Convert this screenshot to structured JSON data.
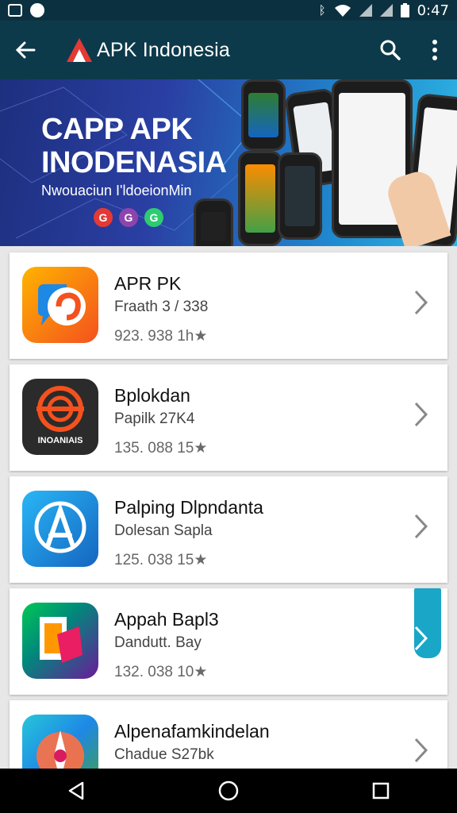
{
  "status_bar": {
    "time": "0:47",
    "icons": [
      "image-icon",
      "sync-icon",
      "bluetooth-icon",
      "wifi-icon",
      "signal-icon",
      "signal-icon",
      "battery-icon"
    ]
  },
  "app_bar": {
    "title": "APK Indonesia",
    "actions": [
      "search-icon",
      "more-vert-icon"
    ],
    "background": "#0d3a4a"
  },
  "banner": {
    "title_line1": "CAPP APK",
    "title_line2": "INODENASIA",
    "subtitle": "Nwouaciun I'ldoeionMin",
    "dots": [
      "G",
      "G",
      "G"
    ]
  },
  "apps": [
    {
      "name": "APR PK",
      "meta": "Fraath 3 / 338",
      "stats": "923. 938 1h",
      "icon": "chat-app-icon"
    },
    {
      "name": "Bplokdan",
      "meta": "Papilk 27K4",
      "stats": "135. 088 15",
      "icon": "target-app-icon",
      "icon_text": "INOANIAIS"
    },
    {
      "name": "Palping Dlpndanta",
      "meta": "Dolesan Sapla",
      "stats": "125. 038 15",
      "icon": "appstore-app-icon"
    },
    {
      "name": "Appah Bapl3",
      "meta": "Dandutt. Bay",
      "stats": "132. 038 10",
      "icon": "layers-app-icon"
    },
    {
      "name": "Alpenafamkindelan",
      "meta": "Chadue S27bk",
      "stats": "",
      "icon": "compass-app-icon"
    }
  ],
  "nav": [
    "back-nav-icon",
    "home-nav-icon",
    "recents-nav-icon"
  ]
}
